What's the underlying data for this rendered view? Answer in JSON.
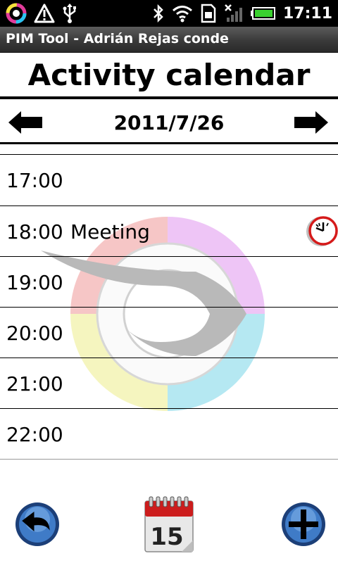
{
  "status_bar": {
    "time": "17:11",
    "left_icons": [
      "app-rings-icon",
      "warning-icon",
      "usb-icon"
    ],
    "right_icons": [
      "bluetooth-icon",
      "wifi-icon",
      "sim-icon",
      "no-signal-icon",
      "battery-icon"
    ]
  },
  "window": {
    "title": "PIM Tool - Adrián Rejas conde"
  },
  "page": {
    "heading": "Activity calendar"
  },
  "date_nav": {
    "date": "2011/7/26",
    "prev_icon": "arrow-left-icon",
    "next_icon": "arrow-right-icon"
  },
  "slots": [
    {
      "time": "17:00",
      "event": "",
      "alarm": false
    },
    {
      "time": "18:00",
      "event": "Meeting",
      "alarm": true
    },
    {
      "time": "19:00",
      "event": "",
      "alarm": false
    },
    {
      "time": "20:00",
      "event": "",
      "alarm": false
    },
    {
      "time": "21:00",
      "event": "",
      "alarm": false
    },
    {
      "time": "22:00",
      "event": "",
      "alarm": false
    }
  ],
  "toolbar": {
    "back_icon": "back-arrow-icon",
    "calendar_icon": "calendar-icon",
    "calendar_day": "15",
    "add_icon": "add-icon"
  },
  "colors": {
    "alarm_red": "#d51a1a",
    "back_blue": "#1c4f8e",
    "calendar_red": "#cc1d1d"
  }
}
